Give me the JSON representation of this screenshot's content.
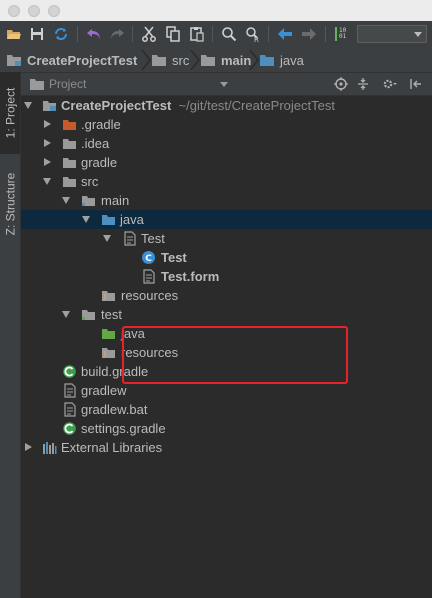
{
  "window": {
    "controls": [
      "close",
      "minimize",
      "zoom"
    ]
  },
  "toolbar": {
    "buttons": [
      "open-folder-icon",
      "save-icon",
      "sync-icon",
      "undo-icon",
      "redo-icon",
      "cut-icon",
      "copy-icon",
      "paste-icon",
      "find-icon",
      "replace-icon",
      "back-icon",
      "forward-icon",
      "build-icon"
    ],
    "run_config": ""
  },
  "navbar": {
    "crumbs": [
      "CreateProjectTest",
      "src",
      "main",
      "java"
    ]
  },
  "sidebar": {
    "tabs": [
      "1: Project",
      "Z: Structure"
    ]
  },
  "project_panel": {
    "view_label": "Project",
    "actions": [
      "target-icon",
      "collapse-icon",
      "settings-icon",
      "hide-icon"
    ]
  },
  "tree": {
    "root": {
      "name": "CreateProjectTest",
      "path": "~/git/test/CreateProjectTest"
    },
    "items": [
      {
        "label": ".gradle"
      },
      {
        "label": ".idea"
      },
      {
        "label": "gradle"
      },
      {
        "label": "src"
      },
      {
        "label": "main"
      },
      {
        "label": "java"
      },
      {
        "label": "Test"
      },
      {
        "label": "Test"
      },
      {
        "label": "Test.form"
      },
      {
        "label": "resources"
      },
      {
        "label": "test"
      },
      {
        "label": "java"
      },
      {
        "label": "resources"
      },
      {
        "label": "build.gradle"
      },
      {
        "label": "gradlew"
      },
      {
        "label": "gradlew.bat"
      },
      {
        "label": "settings.gradle"
      },
      {
        "label": "External Libraries"
      }
    ]
  },
  "colors": {
    "background": "#2b2b2b",
    "panel": "#3c3f41",
    "selection": "#0d293e",
    "highlight_border": "#e8212b",
    "text": "#bbbbbb",
    "folder_blue": "#4e8fbf",
    "folder_green": "#62a844",
    "folder_orange": "#c75a2b"
  }
}
